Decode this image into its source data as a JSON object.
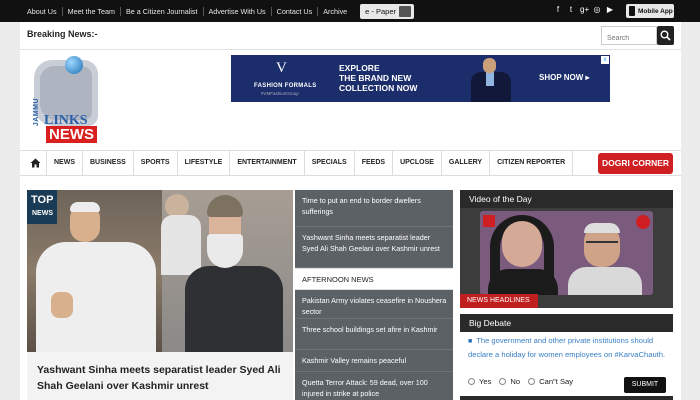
{
  "topbar": {
    "links": [
      "About Us",
      "Meet the Team",
      "Be a Citizen Journalist",
      "Advertise With Us",
      "Contact Us",
      "Archive"
    ],
    "epaper_label": "e - Paper",
    "social_icons": [
      "facebook-icon",
      "twitter-icon",
      "google-plus-icon",
      "instagram-icon",
      "youtube-icon"
    ],
    "social_glyphs": [
      "f",
      "t",
      "g+",
      "◎",
      "▶"
    ],
    "mobile_app_label": "Mobile App"
  },
  "breaking": {
    "label": "Breaking News:-",
    "search_placeholder": "Search"
  },
  "logo": {
    "line1": "JAMMU",
    "line2": "LINKS",
    "line3": "NEWS"
  },
  "ad": {
    "brand": "FASHION FORMALS",
    "brand_handle": "#VMFashionGroup",
    "line1": "EXPLORE",
    "line2": "THE BRAND NEW",
    "line3": "COLLECTION NOW",
    "cta": "SHOP NOW ▸",
    "close": "x"
  },
  "nav": {
    "items": [
      "NEWS",
      "BUSINESS",
      "SPORTS",
      "LIFESTYLE",
      "ENTERTAINMENT",
      "SPECIALS",
      "FEEDS",
      "UPCLOSE",
      "GALLERY",
      "CITIZEN REPORTER"
    ],
    "dogri": "DOGRI CORNER"
  },
  "topnews": {
    "tag_top": "TOP",
    "tag_news": "NEWS",
    "headline": "Yashwant Sinha meets separatist leader Syed Ali Shah Geelani over Kashmir unrest"
  },
  "midlist": {
    "items_top": [
      "Time to put an end to border dwellers sufferings",
      "Yashwant Sinha meets separatist leader Syed Ali Shah Geelani over Kashmir unrest"
    ],
    "section": "AFTERNOON NEWS",
    "items_bottom": [
      "Pakistan Army violates ceasefire in Noushera sector",
      "Three school buildings set afire in Kashmir",
      "Kashmir Valley remains peaceful",
      "Quetta Terror Attack: 59 dead, over 100 injured in strike at police"
    ]
  },
  "video": {
    "title": "Video of the Day",
    "badge": "NEWS HEADLINES"
  },
  "debate": {
    "title": "Big Debate",
    "question": "The government and other private institutions should declare a holiday for women employees on #KarvaChauth.",
    "options": [
      "Yes",
      "No",
      "Can\"t Say"
    ],
    "submit": "SUBMIT"
  },
  "colors": {
    "topbar": "#111111",
    "accent_red": "#d01f22",
    "list_bg": "#5c6166",
    "link_blue": "#3a7fc4"
  }
}
